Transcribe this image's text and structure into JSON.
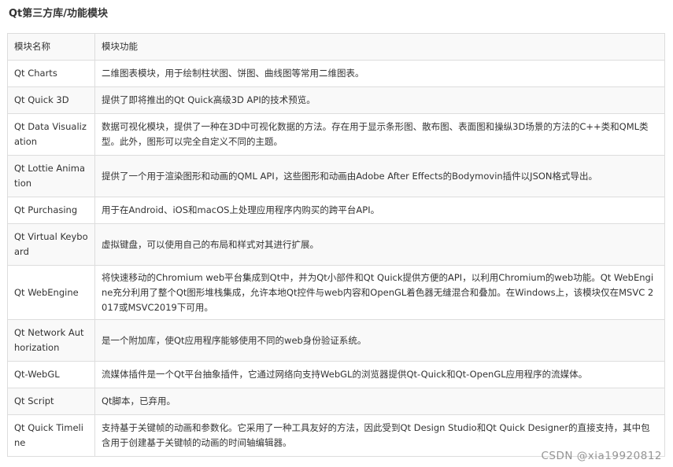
{
  "title": "Qt第三方库/功能模块",
  "table": {
    "headers": [
      "模块名称",
      "模块功能"
    ],
    "rows": [
      {
        "name": "Qt Charts",
        "desc": "二维图表模块，用于绘制柱状图、饼图、曲线图等常用二维图表。"
      },
      {
        "name": "Qt Quick 3D",
        "desc": "提供了即将推出的Qt Quick高级3D API的技术预览。"
      },
      {
        "name": "Qt Data Visualization",
        "desc": "数据可视化模块，提供了一种在3D中可视化数据的方法。存在用于显示条形图、散布图、表面图和操纵3D场景的方法的C++类和QML类型。此外，图形可以完全自定义不同的主题。"
      },
      {
        "name": "Qt Lottie Animation",
        "desc": "提供了一个用于渲染图形和动画的QML API，这些图形和动画由Adobe After Effects的Bodymovin插件以JSON格式导出。"
      },
      {
        "name": "Qt Purchasing",
        "desc": "用于在Android、iOS和macOS上处理应用程序内购买的跨平台API。"
      },
      {
        "name": "Qt Virtual Keyboard",
        "desc": "虚拟键盘，可以使用自己的布局和样式对其进行扩展。"
      },
      {
        "name": "Qt WebEngine",
        "desc": "将快速移动的Chromium web平台集成到Qt中，并为Qt小部件和Qt Quick提供方便的API，以利用Chromium的web功能。Qt WebEngine充分利用了整个Qt图形堆栈集成，允许本地Qt控件与web内容和OpenGL着色器无缝混合和叠加。在Windows上，该模块仅在MSVC 2017或MSVC2019下可用。"
      },
      {
        "name": "Qt Network Authorization",
        "desc": "是一个附加库，使Qt应用程序能够使用不同的web身份验证系统。"
      },
      {
        "name": "Qt-WebGL",
        "desc": "流媒体插件是一个Qt平台抽象插件，它通过网络向支持WebGL的浏览器提供Qt-Quick和Qt-OpenGL应用程序的流媒体。"
      },
      {
        "name": "Qt Script",
        "desc": "Qt脚本，已弃用。"
      },
      {
        "name": "Qt Quick Timeline",
        "desc": "支持基于关键帧的动画和参数化。它采用了一种工具友好的方法，因此受到Qt Design Studio和Qt Quick Designer的直接支持，其中包含用于创建基于关键帧的动画的时间轴编辑器。"
      }
    ]
  },
  "watermark": "CSDN @xia19920812"
}
